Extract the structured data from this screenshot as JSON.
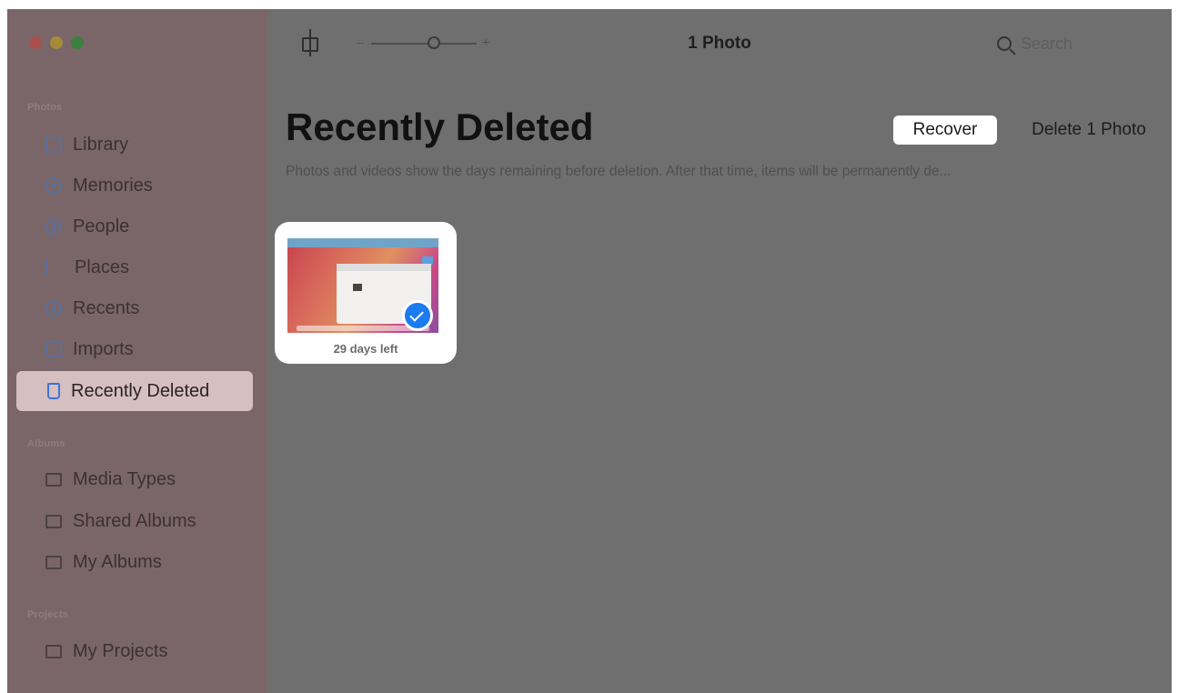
{
  "window": {
    "title": "1 Photo",
    "search_placeholder": "Search"
  },
  "sidebar": {
    "sections": [
      {
        "label": "Photos",
        "items": [
          {
            "label": "Library",
            "icon": "library-icon"
          },
          {
            "label": "Memories",
            "icon": "memories-icon"
          },
          {
            "label": "People",
            "icon": "people-icon"
          },
          {
            "label": "Places",
            "icon": "places-icon"
          },
          {
            "label": "Recents",
            "icon": "recents-icon"
          },
          {
            "label": "Imports",
            "icon": "imports-icon"
          },
          {
            "label": "Recently Deleted",
            "icon": "trash-icon",
            "selected": true
          }
        ]
      },
      {
        "label": "Albums",
        "items": [
          {
            "label": "Media Types",
            "icon": "folder-icon"
          },
          {
            "label": "Shared Albums",
            "icon": "shared-folder-icon"
          },
          {
            "label": "My Albums",
            "icon": "folder-icon"
          }
        ]
      },
      {
        "label": "Projects",
        "items": [
          {
            "label": "My Projects",
            "icon": "folder-icon"
          }
        ]
      }
    ]
  },
  "main": {
    "title": "Recently Deleted",
    "recover_label": "Recover",
    "delete_label": "Delete 1 Photo",
    "subtitle": "Photos and videos show the days remaining before deletion. After that time, items will be permanently de...",
    "items": [
      {
        "caption": "29 days left",
        "selected": true
      }
    ]
  },
  "colors": {
    "sidebar_bg": "#7a6668",
    "selected_bg": "#d6bfc1",
    "accent": "#1b7bf0"
  }
}
